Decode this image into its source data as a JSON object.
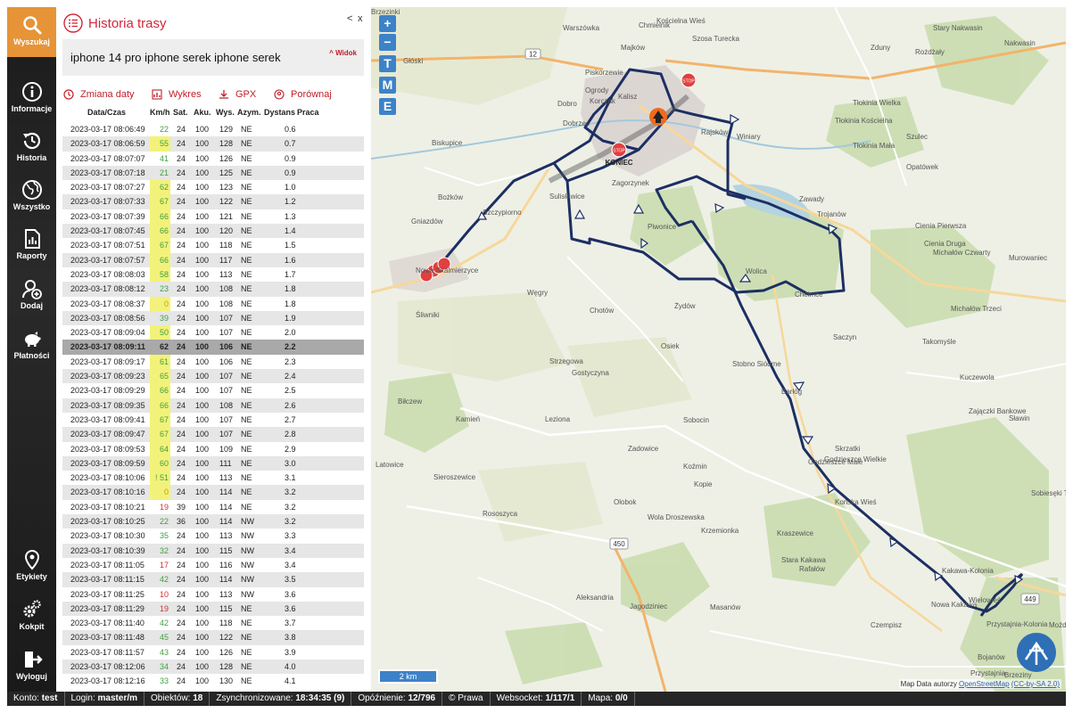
{
  "sidebar": {
    "items": [
      {
        "label": "Wyszukaj",
        "icon": "search-icon",
        "active": true
      },
      {
        "label": "Informacje",
        "icon": "info-icon"
      },
      {
        "label": "Historia",
        "icon": "history-icon"
      },
      {
        "label": "Wszystko",
        "icon": "globe-icon"
      },
      {
        "label": "Raporty",
        "icon": "report-icon"
      },
      {
        "label": "Dodaj",
        "icon": "add-user-icon"
      },
      {
        "label": "Płatności",
        "icon": "piggy-bank-icon"
      },
      {
        "label": "Etykiety",
        "icon": "location-pin-icon"
      },
      {
        "label": "Kokpit",
        "icon": "gears-icon"
      },
      {
        "label": "Wyloguj",
        "icon": "logout-icon"
      }
    ]
  },
  "panel": {
    "title": "Historia trasy",
    "collapse": "<",
    "close": "x",
    "device_name": "iphone 14 pro iphone serek iphone serek",
    "view_toggle": "^ Widok",
    "tools": {
      "change_date": "Zmiana daty",
      "chart": "Wykres",
      "gpx": "GPX",
      "compare": "Porównaj"
    },
    "columns": [
      "Data/Czas",
      "Km/h",
      "Sat.",
      "Aku.",
      "Wys.",
      "Azym.",
      "Dystans",
      "Praca"
    ],
    "rows": [
      {
        "time": "2023-03-17 08:06:49",
        "speed": "22",
        "sat": "24",
        "bat": "100",
        "alt": "129",
        "az": "NE",
        "dist": "0.6"
      },
      {
        "time": "2023-03-17 08:06:59",
        "speed": "55",
        "sat": "24",
        "bat": "100",
        "alt": "128",
        "az": "NE",
        "dist": "0.7"
      },
      {
        "time": "2023-03-17 08:07:07",
        "speed": "41",
        "sat": "24",
        "bat": "100",
        "alt": "126",
        "az": "NE",
        "dist": "0.9"
      },
      {
        "time": "2023-03-17 08:07:18",
        "speed": "21",
        "sat": "24",
        "bat": "100",
        "alt": "125",
        "az": "NE",
        "dist": "0.9"
      },
      {
        "time": "2023-03-17 08:07:27",
        "speed": "62",
        "sat": "24",
        "bat": "100",
        "alt": "123",
        "az": "NE",
        "dist": "1.0"
      },
      {
        "time": "2023-03-17 08:07:33",
        "speed": "67",
        "sat": "24",
        "bat": "100",
        "alt": "122",
        "az": "NE",
        "dist": "1.2"
      },
      {
        "time": "2023-03-17 08:07:39",
        "speed": "66",
        "sat": "24",
        "bat": "100",
        "alt": "121",
        "az": "NE",
        "dist": "1.3"
      },
      {
        "time": "2023-03-17 08:07:45",
        "speed": "66",
        "sat": "24",
        "bat": "100",
        "alt": "120",
        "az": "NE",
        "dist": "1.4"
      },
      {
        "time": "2023-03-17 08:07:51",
        "speed": "67",
        "sat": "24",
        "bat": "100",
        "alt": "118",
        "az": "NE",
        "dist": "1.5"
      },
      {
        "time": "2023-03-17 08:07:57",
        "speed": "66",
        "sat": "24",
        "bat": "100",
        "alt": "117",
        "az": "NE",
        "dist": "1.6"
      },
      {
        "time": "2023-03-17 08:08:03",
        "speed": "58",
        "sat": "24",
        "bat": "100",
        "alt": "113",
        "az": "NE",
        "dist": "1.7"
      },
      {
        "time": "2023-03-17 08:08:12",
        "speed": "23",
        "sat": "24",
        "bat": "100",
        "alt": "108",
        "az": "NE",
        "dist": "1.8"
      },
      {
        "time": "2023-03-17 08:08:37",
        "speed": "0",
        "sat": "24",
        "bat": "100",
        "alt": "108",
        "az": "NE",
        "dist": "1.8"
      },
      {
        "time": "2023-03-17 08:08:56",
        "speed": "39",
        "sat": "24",
        "bat": "100",
        "alt": "107",
        "az": "NE",
        "dist": "1.9"
      },
      {
        "time": "2023-03-17 08:09:04",
        "speed": "50",
        "sat": "24",
        "bat": "100",
        "alt": "107",
        "az": "NE",
        "dist": "2.0"
      },
      {
        "time": "2023-03-17 08:09:11",
        "speed": "62",
        "sat": "24",
        "bat": "100",
        "alt": "106",
        "az": "NE",
        "dist": "2.2",
        "selected": true
      },
      {
        "time": "2023-03-17 08:09:17",
        "speed": "61",
        "sat": "24",
        "bat": "100",
        "alt": "106",
        "az": "NE",
        "dist": "2.3"
      },
      {
        "time": "2023-03-17 08:09:23",
        "speed": "65",
        "sat": "24",
        "bat": "100",
        "alt": "107",
        "az": "NE",
        "dist": "2.4"
      },
      {
        "time": "2023-03-17 08:09:29",
        "speed": "66",
        "sat": "24",
        "bat": "100",
        "alt": "107",
        "az": "NE",
        "dist": "2.5"
      },
      {
        "time": "2023-03-17 08:09:35",
        "speed": "66",
        "sat": "24",
        "bat": "100",
        "alt": "108",
        "az": "NE",
        "dist": "2.6"
      },
      {
        "time": "2023-03-17 08:09:41",
        "speed": "67",
        "sat": "24",
        "bat": "100",
        "alt": "107",
        "az": "NE",
        "dist": "2.7"
      },
      {
        "time": "2023-03-17 08:09:47",
        "speed": "67",
        "sat": "24",
        "bat": "100",
        "alt": "107",
        "az": "NE",
        "dist": "2.8"
      },
      {
        "time": "2023-03-17 08:09:53",
        "speed": "64",
        "sat": "24",
        "bat": "100",
        "alt": "109",
        "az": "NE",
        "dist": "2.9"
      },
      {
        "time": "2023-03-17 08:09:59",
        "speed": "60",
        "sat": "24",
        "bat": "100",
        "alt": "111",
        "az": "NE",
        "dist": "3.0"
      },
      {
        "time": "2023-03-17 08:10:06",
        "speed": "! 51",
        "sat": "24",
        "bat": "100",
        "alt": "113",
        "az": "NE",
        "dist": "3.1"
      },
      {
        "time": "2023-03-17 08:10:16",
        "speed": "0",
        "sat": "24",
        "bat": "100",
        "alt": "114",
        "az": "NE",
        "dist": "3.2"
      },
      {
        "time": "2023-03-17 08:10:21",
        "speed": "19",
        "sat": "39",
        "bat": "100",
        "alt": "114",
        "az": "NE",
        "dist": "3.2"
      },
      {
        "time": "2023-03-17 08:10:25",
        "speed": "22",
        "sat": "36",
        "bat": "100",
        "alt": "114",
        "az": "NW",
        "dist": "3.2"
      },
      {
        "time": "2023-03-17 08:10:30",
        "speed": "35",
        "sat": "24",
        "bat": "100",
        "alt": "113",
        "az": "NW",
        "dist": "3.3"
      },
      {
        "time": "2023-03-17 08:10:39",
        "speed": "32",
        "sat": "24",
        "bat": "100",
        "alt": "115",
        "az": "NW",
        "dist": "3.4"
      },
      {
        "time": "2023-03-17 08:11:05",
        "speed": "17",
        "sat": "24",
        "bat": "100",
        "alt": "116",
        "az": "NW",
        "dist": "3.4"
      },
      {
        "time": "2023-03-17 08:11:15",
        "speed": "42",
        "sat": "24",
        "bat": "100",
        "alt": "114",
        "az": "NW",
        "dist": "3.5"
      },
      {
        "time": "2023-03-17 08:11:25",
        "speed": "10",
        "sat": "24",
        "bat": "100",
        "alt": "113",
        "az": "NW",
        "dist": "3.6"
      },
      {
        "time": "2023-03-17 08:11:29",
        "speed": "19",
        "sat": "24",
        "bat": "100",
        "alt": "115",
        "az": "NE",
        "dist": "3.6"
      },
      {
        "time": "2023-03-17 08:11:40",
        "speed": "42",
        "sat": "24",
        "bat": "100",
        "alt": "118",
        "az": "NE",
        "dist": "3.7"
      },
      {
        "time": "2023-03-17 08:11:48",
        "speed": "45",
        "sat": "24",
        "bat": "100",
        "alt": "122",
        "az": "NE",
        "dist": "3.8"
      },
      {
        "time": "2023-03-17 08:11:57",
        "speed": "43",
        "sat": "24",
        "bat": "100",
        "alt": "126",
        "az": "NE",
        "dist": "3.9"
      },
      {
        "time": "2023-03-17 08:12:06",
        "speed": "34",
        "sat": "24",
        "bat": "100",
        "alt": "128",
        "az": "NE",
        "dist": "4.0"
      },
      {
        "time": "2023-03-17 08:12:16",
        "speed": "33",
        "sat": "24",
        "bat": "100",
        "alt": "130",
        "az": "NE",
        "dist": "4.1"
      }
    ]
  },
  "map": {
    "zoom_in": "+",
    "zoom_out": "−",
    "layer_buttons": [
      "T",
      "M",
      "E"
    ],
    "scale": "2 km",
    "attribution_prefix": "Map Data autorzy",
    "attribution_link": "OpenStreetMap",
    "attribution_license": "(CC-by-SA 2.0)",
    "end_label": "KONIEC",
    "stop_label": "STOP",
    "road_badges": [
      "12",
      "450",
      "449"
    ],
    "places": [
      {
        "name": "Kalisz",
        "size": 12
      },
      {
        "name": "Nowe Skalmierzyce",
        "size": 11
      },
      {
        "name": "Opatówek",
        "size": 11
      },
      {
        "name": "Warszówka"
      },
      {
        "name": "Kościelna Wieś"
      },
      {
        "name": "Chmielnik"
      },
      {
        "name": "Majków"
      },
      {
        "name": "Szosa Turecka"
      },
      {
        "name": "Stary Nakwasin"
      },
      {
        "name": "Nakwasin"
      },
      {
        "name": "Zduny"
      },
      {
        "name": "Rożdżały"
      },
      {
        "name": "Głóski"
      },
      {
        "name": "Piskorzewie"
      },
      {
        "name": "Ogrody"
      },
      {
        "name": "Korczak"
      },
      {
        "name": "Dobro"
      },
      {
        "name": "Dobrzec"
      },
      {
        "name": "Winiary"
      },
      {
        "name": "Rajsków"
      },
      {
        "name": "Tłokinia Wielka"
      },
      {
        "name": "Tłokinia Kościelna"
      },
      {
        "name": "Tłokinia Mała"
      },
      {
        "name": "Szulec"
      },
      {
        "name": "Biskupice"
      },
      {
        "name": "Bożków"
      },
      {
        "name": "Gniazdów"
      },
      {
        "name": "Szczypiorno"
      },
      {
        "name": "Zagorzynek"
      },
      {
        "name": "Sulisławice"
      },
      {
        "name": "Piwonice"
      },
      {
        "name": "Zawady"
      },
      {
        "name": "Trojanów"
      },
      {
        "name": "Cienia Pierwsza"
      },
      {
        "name": "Cienia Druga"
      },
      {
        "name": "Michałów Czwarty"
      },
      {
        "name": "Murowaniec"
      },
      {
        "name": "Wolica"
      },
      {
        "name": "Chełmce"
      },
      {
        "name": "Michałów Trzeci"
      },
      {
        "name": "Żydów"
      },
      {
        "name": "Chotów"
      },
      {
        "name": "Węgry"
      },
      {
        "name": "Śliwniki"
      },
      {
        "name": "Saczyn"
      },
      {
        "name": "Takomyśle"
      },
      {
        "name": "Osiek"
      },
      {
        "name": "Strzegowa"
      },
      {
        "name": "Stobno Siódme"
      },
      {
        "name": "Gostyczyna"
      },
      {
        "name": "Kuczewola"
      },
      {
        "name": "Biłczew"
      },
      {
        "name": "Barłóg"
      },
      {
        "name": "Zajączki Bankowe"
      },
      {
        "name": "Kamień"
      },
      {
        "name": "Leziona"
      },
      {
        "name": "Sobocin"
      },
      {
        "name": "Sławin"
      },
      {
        "name": "Zadowice"
      },
      {
        "name": "Godzieszce Małe"
      },
      {
        "name": "Godzieszce Wielkie"
      },
      {
        "name": "Skrzatki"
      },
      {
        "name": "Latowice"
      },
      {
        "name": "Koźmin"
      },
      {
        "name": "Sieroszewice"
      },
      {
        "name": "Olobok"
      },
      {
        "name": "Kopie"
      },
      {
        "name": "Końska Wieś"
      },
      {
        "name": "Sobiesęki Trzecie"
      },
      {
        "name": "Rososzyca"
      },
      {
        "name": "Wola Droszewska"
      },
      {
        "name": "Krzemionka"
      },
      {
        "name": "Kraszewice"
      },
      {
        "name": "Stara Kakawa"
      },
      {
        "name": "Rafałów"
      },
      {
        "name": "Kakawa-Kolonia"
      },
      {
        "name": "Aleksandria"
      },
      {
        "name": "Masanów"
      },
      {
        "name": "Nowa Kakawa"
      },
      {
        "name": "Jagodziniec"
      },
      {
        "name": "Wielowieś"
      },
      {
        "name": "Bojanów"
      },
      {
        "name": "Przystajnia"
      },
      {
        "name": "Przystajnia-Kolonia"
      },
      {
        "name": "Brzeziny"
      },
      {
        "name": "Czempisz"
      },
      {
        "name": "Moźdżec"
      },
      {
        "name": "Brzezinki"
      }
    ]
  },
  "status": {
    "account_label": "Konto:",
    "account": "test",
    "login_label": "Login:",
    "login": "master/m",
    "objects_label": "Obiektów:",
    "objects": "18",
    "sync_label": "Zsynchronizowane:",
    "sync": "18:34:35 (9)",
    "delay_label": "Opóźnienie:",
    "delay": "12/796",
    "rights": "© Prawa",
    "websocket_label": "Websocket:",
    "websocket": "1/117/1",
    "map_label": "Mapa:",
    "map_value": "0/0"
  },
  "colors": {
    "accent_orange": "#e69437",
    "title_red": "#d0283a",
    "route_navy": "#1c2f63",
    "speed_yellow": "#f2f27a",
    "speed_green": "#40a040",
    "speed_red": "#d03030"
  }
}
